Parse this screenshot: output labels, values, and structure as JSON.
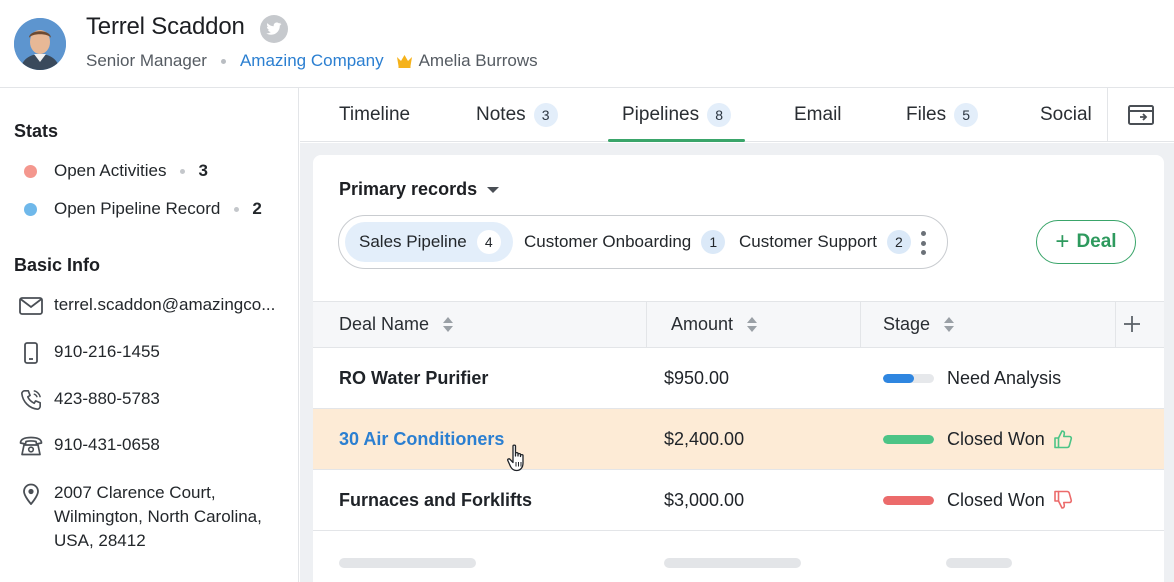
{
  "contact": {
    "name": "Terrel Scaddon",
    "title": "Senior Manager",
    "company": "Amazing Company",
    "owner": "Amelia Burrows"
  },
  "sidebar": {
    "stats_title": "Stats",
    "stats": [
      {
        "label": "Open Activities",
        "count": "3",
        "color": "#f4978e"
      },
      {
        "label": "Open Pipeline Record",
        "count": "2",
        "color": "#6fb8ea"
      }
    ],
    "basic_info_title": "Basic Info",
    "email": "terrel.scaddon@amazingco...",
    "mobile": "910-216-1455",
    "phone": "423-880-5783",
    "landline": "910-431-0658",
    "address_line1": "2007 Clarence Court,",
    "address_line2": "Wilmington, North Carolina,",
    "address_line3": "USA, 28412"
  },
  "tabs": [
    {
      "label": "Timeline",
      "badge": ""
    },
    {
      "label": "Notes",
      "badge": "3"
    },
    {
      "label": "Pipelines",
      "badge": "8"
    },
    {
      "label": "Email",
      "badge": ""
    },
    {
      "label": "Files",
      "badge": "5"
    },
    {
      "label": "Social",
      "badge": ""
    }
  ],
  "active_tab": "Pipelines",
  "records": {
    "heading": "Primary records",
    "pipelines": [
      {
        "label": "Sales Pipeline",
        "count": "4"
      },
      {
        "label": "Customer Onboarding",
        "count": "1"
      },
      {
        "label": "Customer Support",
        "count": "2"
      }
    ],
    "add_button_label": "Deal"
  },
  "table": {
    "columns": [
      "Deal Name",
      "Amount",
      "Stage"
    ],
    "rows": [
      {
        "deal": "RO Water Purifier",
        "amount": "$950.00",
        "stage": "Need Analysis",
        "progress": 0.6,
        "bar_color": "#2f86e0"
      },
      {
        "deal": "30 Air Conditioners",
        "amount": "$2,400.00",
        "stage": "Closed Won",
        "progress": 1.0,
        "bar_color": "#4cc486",
        "outcome": "won"
      },
      {
        "deal": "Furnaces and Forklifts",
        "amount": "$3,000.00",
        "stage": "Closed Won",
        "progress": 1.0,
        "bar_color": "#ec6b6b",
        "outcome": "lost"
      }
    ]
  },
  "colors": {
    "accent_green": "#3aa56a",
    "link_blue": "#2b7fd1",
    "hover_row": "#fdebd6"
  }
}
